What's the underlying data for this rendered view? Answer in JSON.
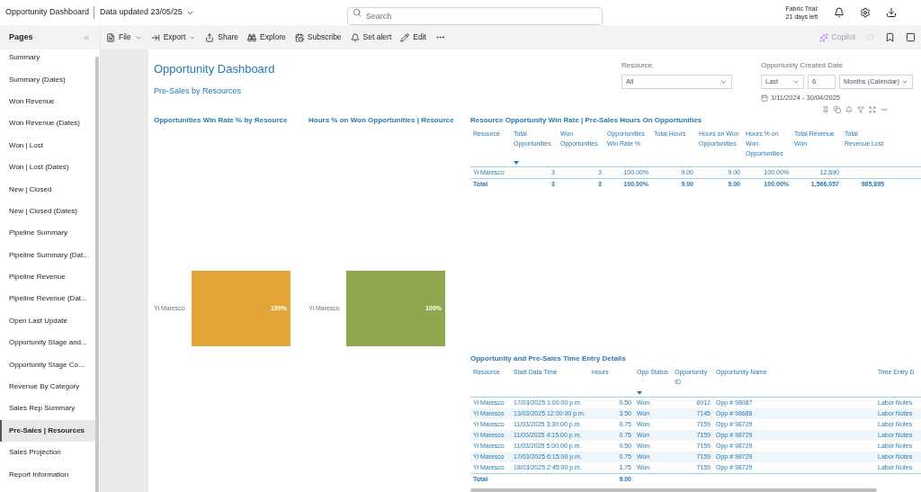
{
  "header": {
    "title": "Opportunity Dashboard",
    "updated": "Data updated 23/05/25",
    "search": {
      "placeholder": "Search"
    },
    "trial": [
      "Fabric Trial:",
      "21 days left"
    ]
  },
  "toolbar": {
    "items": [
      {
        "kind": "file",
        "label": "File",
        "dropdown": true
      },
      {
        "kind": "export",
        "label": "Export",
        "dropdown": true
      },
      {
        "kind": "share",
        "label": "Share",
        "dropdown": false
      },
      {
        "kind": "explore",
        "label": "Explore",
        "dropdown": false
      },
      {
        "kind": "subscribe",
        "label": "Subscribe",
        "dropdown": false
      },
      {
        "kind": "alert",
        "label": "Set alert",
        "dropdown": false
      },
      {
        "kind": "edit",
        "label": "Edit",
        "dropdown": false
      }
    ],
    "copilot": {
      "label": "Copilot",
      "disabled": true
    }
  },
  "sidebar": {
    "title": "Pages",
    "items": [
      {
        "label": "Summary",
        "selected": false
      },
      {
        "label": "Summary (Dates)",
        "selected": false
      },
      {
        "label": "Won Revenue",
        "selected": false
      },
      {
        "label": "Won Revenue (Dates)",
        "selected": false
      },
      {
        "label": "Won | Lost",
        "selected": false
      },
      {
        "label": "Won | Lost (Dates)",
        "selected": false
      },
      {
        "label": "New | Closed",
        "selected": false
      },
      {
        "label": "New | Closed (Dates)",
        "selected": false
      },
      {
        "label": "Pipeline Summary",
        "selected": false
      },
      {
        "label": "Pipeline Summary (Dat...",
        "selected": false
      },
      {
        "label": "Pipeline Revenue",
        "selected": false
      },
      {
        "label": "Pipeline Revenue (Dat...",
        "selected": false
      },
      {
        "label": "Open Last Update",
        "selected": false
      },
      {
        "label": "Opportunity Stage and...",
        "selected": false
      },
      {
        "label": "Opportunity Stage Co...",
        "selected": false
      },
      {
        "label": "Revenue By Category",
        "selected": false
      },
      {
        "label": "Sales Rep Summary",
        "selected": false
      },
      {
        "label": "Pre-Sales | Resources",
        "selected": true
      },
      {
        "label": "Sales Projection",
        "selected": false
      },
      {
        "label": "Report Information",
        "selected": false
      }
    ]
  },
  "report": {
    "title": "Opportunity Dashboard",
    "subtitle": "Pre-Sales by Resources",
    "resource_slicer": {
      "label": "Resource",
      "value": "All"
    },
    "date_slicer": {
      "label": "Opportunity Created Date",
      "period": "Last",
      "count": "6",
      "unit": "Months (Calendar)",
      "range": "1/11/2024 - 30/04/2025"
    },
    "charts": [
      {
        "title": "Opportunities Win Rate % by Resource",
        "category": "Yi Maresco",
        "value_label": "100%",
        "color": "#e3a438"
      },
      {
        "title": "Hours % on Won Opportunities | Resource",
        "category": "Yi Maresco",
        "value_label": "100%",
        "color": "#8fa84f"
      }
    ],
    "summary_table": {
      "title": "Resource Opportunity Win Rate | Pre-Sales Hours On Opportunities",
      "columns": [
        {
          "label": "Resource",
          "sorted": false
        },
        {
          "label": "Total Opportunities",
          "sorted": true
        },
        {
          "label": "Won Opportunities",
          "sorted": false
        },
        {
          "label": "Opportunities Win Rate %",
          "sorted": false
        },
        {
          "label": "Total Hours",
          "sorted": false
        },
        {
          "label": "Hours on Won Opportunities",
          "sorted": false
        },
        {
          "label": "Hours % on Won Opportunities",
          "sorted": false
        },
        {
          "label": "Total Revenue Won",
          "sorted": false
        },
        {
          "label": "Total Revenue Lost",
          "sorted": false
        }
      ],
      "rows": [
        [
          "Yi Maresco",
          "3",
          "3",
          "100.00%",
          "9.00",
          "9.00",
          "100.00%",
          "12,690",
          ""
        ]
      ],
      "total": [
        "Total",
        "3",
        "3",
        "100.00%",
        "9.00",
        "9.00",
        "100.00%",
        "1,566,057",
        "985,895"
      ]
    },
    "detail_table": {
      "title": "Opportunity and Pre-Sales Time Entry Details",
      "columns": [
        {
          "label": "Resource",
          "sorted": false
        },
        {
          "label": "Start Data Time",
          "sorted": false
        },
        {
          "label": "Hours",
          "sorted": false
        },
        {
          "label": "Opp Status",
          "sorted": true
        },
        {
          "label": "Opportunity ID",
          "sorted": false
        },
        {
          "label": "Opportunity Name",
          "sorted": false
        },
        {
          "label": "Time Entry D",
          "sorted": false
        }
      ],
      "rows": [
        [
          "Yi Maresco",
          "17/03/2025 1:00:00 p.m.",
          "0.50",
          "Won",
          "6912",
          "Opp # 98087",
          "Labor Notes"
        ],
        [
          "Yi Maresco",
          "13/03/2025 12:00:00 p.m.",
          "3.50",
          "Won",
          "7145",
          "Opp # 98688",
          "Labor Notes"
        ],
        [
          "Yi Maresco",
          "11/03/2025 3:30:00 p.m.",
          "0.75",
          "Won",
          "7159",
          "Opp # 98729",
          "Labor Notes"
        ],
        [
          "Yi Maresco",
          "11/03/2025 4:15:00 p.m.",
          "0.75",
          "Won",
          "7159",
          "Opp # 98729",
          "Labor Notes"
        ],
        [
          "Yi Maresco",
          "11/03/2025 5:00:00 p.m.",
          "0.50",
          "Won",
          "7159",
          "Opp # 98729",
          "Labor Notes"
        ],
        [
          "Yi Maresco",
          "17/03/2025 6:15:00 p.m.",
          "0.75",
          "Won",
          "7159",
          "Opp # 98729",
          "Labor Notes"
        ],
        [
          "Yi Maresco",
          "18/03/2025 2:45:00 p.m.",
          "1.75",
          "Won",
          "7159",
          "Opp # 98729",
          "Labor Notes"
        ]
      ],
      "total": {
        "label": "Total",
        "hours": "9.00"
      }
    }
  }
}
